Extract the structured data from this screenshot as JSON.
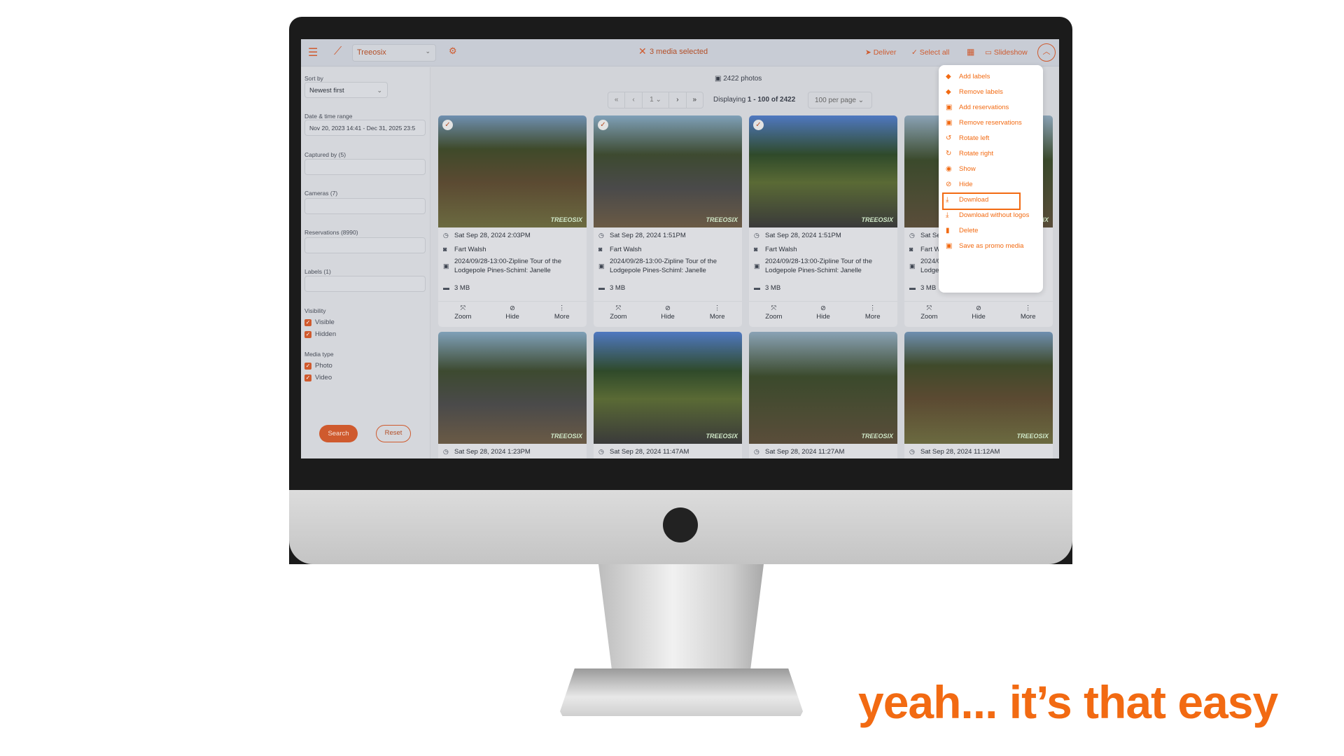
{
  "header": {
    "site": "Treeosix",
    "selected_text": "3 media selected",
    "deliver": "Deliver",
    "select_all": "Select all",
    "slideshow": "Slideshow"
  },
  "sidebar": {
    "sort_label": "Sort by",
    "sort_value": "Newest first",
    "date_label": "Date & time range",
    "date_value": "Nov 20, 2023 14:41 - Dec 31, 2025 23:5",
    "captured_label": "Captured by (5)",
    "cameras_label": "Cameras (7)",
    "reservations_label": "Reservations (8990)",
    "labels_label": "Labels (1)",
    "visibility_label": "Visibility",
    "visible": "Visible",
    "hidden": "Hidden",
    "media_type_label": "Media type",
    "photo": "Photo",
    "video": "Video",
    "search": "Search",
    "reset": "Reset"
  },
  "main": {
    "count": "2422 photos",
    "page": "1",
    "displaying_prefix": "Displaying ",
    "displaying_range": "1 - 100 of 2422",
    "per_page": "100 per page"
  },
  "cards": [
    {
      "date": "Sat Sep 28, 2024 2:03PM",
      "photographer": "Fart Walsh",
      "reservation": "2024/09/28-13:00-Zipline Tour of the",
      "reservation2": "Lodgepole Pines-Schiml: Janelle",
      "size": "3 MB",
      "selected": true,
      "watermark": "TREEOSIX"
    },
    {
      "date": "Sat Sep 28, 2024 1:51PM",
      "photographer": "Fart Walsh",
      "reservation": "2024/09/28-13:00-Zipline Tour of the",
      "reservation2": "Lodgepole Pines-Schiml: Janelle",
      "size": "3 MB",
      "selected": true,
      "watermark": "TREEOSIX"
    },
    {
      "date": "Sat Sep 28, 2024 1:51PM",
      "photographer": "Fart Walsh",
      "reservation": "2024/09/28-13:00-Zipline Tour of the",
      "reservation2": "Lodgepole Pines-Schiml: Janelle",
      "size": "3 MB",
      "selected": true,
      "watermark": "TREEOSIX"
    },
    {
      "date": "Sat Sep 28, 2024 1:51PM",
      "photographer": "Fart Walsh",
      "reservation": "2024/09/28-13:00-Zipline Tour of the",
      "reservation2": "Lodgepole Pines-Schiml: Janelle",
      "size": "3 MB",
      "selected": false,
      "watermark": "TREEOSIX"
    },
    {
      "date": "Sat Sep 28, 2024 1:23PM",
      "watermark": "TREEOSIX"
    },
    {
      "date": "Sat Sep 28, 2024 11:47AM",
      "watermark": "TREEOSIX"
    },
    {
      "date": "Sat Sep 28, 2024 11:27AM",
      "watermark": "TREEOSIX"
    },
    {
      "date": "Sat Sep 28, 2024 11:12AM",
      "watermark": "TREEOSIX"
    }
  ],
  "card_actions": {
    "zoom": "Zoom",
    "hide": "Hide",
    "more": "More"
  },
  "menu": [
    {
      "label": "Add labels",
      "icon": "tag-icon"
    },
    {
      "label": "Remove labels",
      "icon": "tag-icon"
    },
    {
      "label": "Add reservations",
      "icon": "calendar-clock-icon"
    },
    {
      "label": "Remove reservations",
      "icon": "calendar-clock-icon"
    },
    {
      "label": "Rotate left",
      "icon": "rotate-left-icon"
    },
    {
      "label": "Rotate right",
      "icon": "rotate-right-icon"
    },
    {
      "label": "Show",
      "icon": "eye-icon"
    },
    {
      "label": "Hide",
      "icon": "eye-slash-icon"
    },
    {
      "label": "Download",
      "icon": "download-icon",
      "highlighted": true
    },
    {
      "label": "Download without logos",
      "icon": "download-icon"
    },
    {
      "label": "Delete",
      "icon": "trash-icon"
    },
    {
      "label": "Save as promo media",
      "icon": "folder-star-icon"
    }
  ],
  "tagline": "yeah... it’s that easy",
  "colors": {
    "accent": "#cf5a2e",
    "menu_accent": "#f26a12",
    "tagline": "#f26a12"
  }
}
